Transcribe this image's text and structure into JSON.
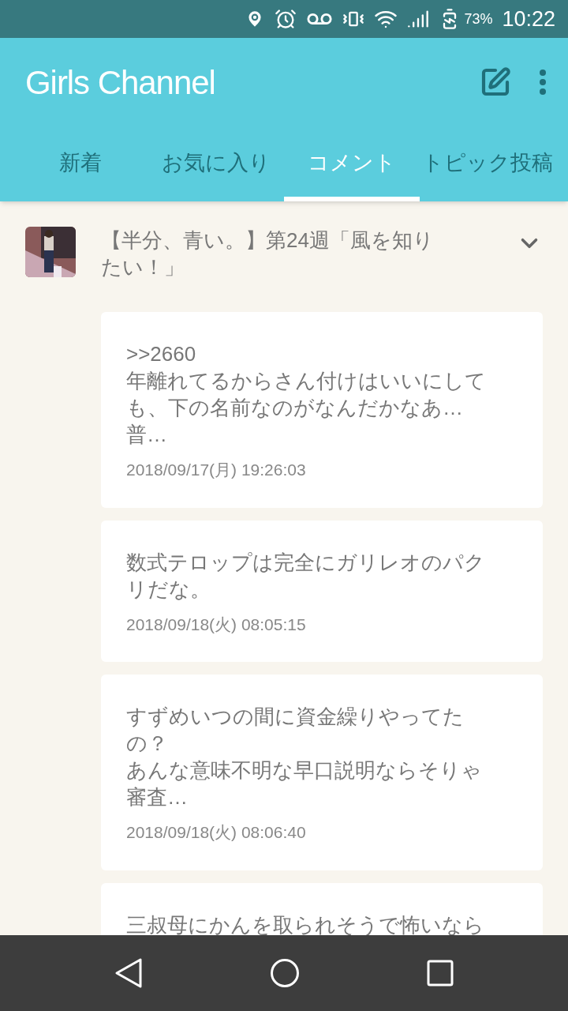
{
  "status_bar": {
    "battery": "73%",
    "time": "10:22"
  },
  "app_bar": {
    "title": "Girls Channel"
  },
  "tabs": [
    {
      "label": "新着",
      "selected": false
    },
    {
      "label": "お気に入り",
      "selected": false
    },
    {
      "label": "コメント",
      "selected": true
    },
    {
      "label": "トピック投稿",
      "selected": false
    }
  ],
  "topic": {
    "title": "【半分、青い。】第24週「風を知りたい！」",
    "expanded": false
  },
  "comments": [
    {
      "lines": [
        ">>2660",
        "年離れてるからさん付けはいいにしても、下の名前なのがなんだかなあ…",
        "普…"
      ],
      "date": "2018/09/17(月) 19:26:03"
    },
    {
      "lines": [
        "数式テロップは完全にガリレオのパクリだな。"
      ],
      "date": "2018/09/18(火) 08:05:15"
    },
    {
      "lines": [
        "すずめいつの間に資金繰りやってたの？",
        "あんな意味不明な早口説明ならそりゃ審査…"
      ],
      "date": "2018/09/18(火) 08:06:40"
    },
    {
      "lines": [
        "三叔母にかんを取られそうで怖いなら"
      ]
    }
  ]
}
